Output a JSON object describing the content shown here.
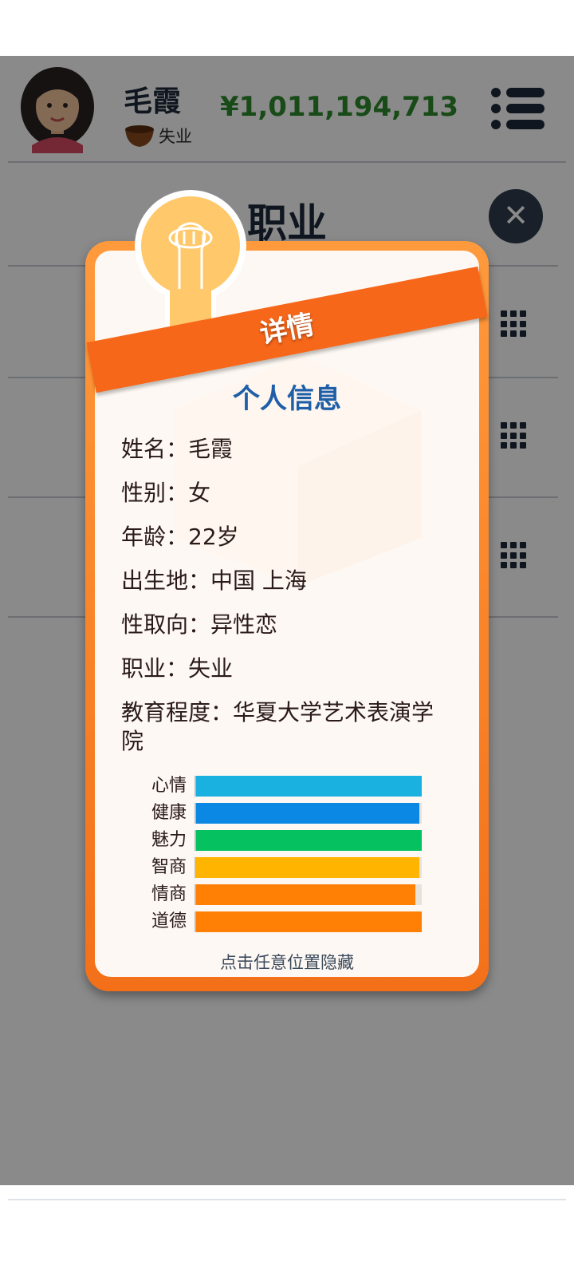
{
  "header": {
    "player_name": "毛霞",
    "job": "失业",
    "money": "¥1,011,194,713"
  },
  "page": {
    "title": "职业"
  },
  "modal": {
    "banner": "详情",
    "title": "个人信息",
    "info": [
      {
        "label": "姓名：",
        "value": "毛霞"
      },
      {
        "label": "性别：",
        "value": "女"
      },
      {
        "label": "年龄：",
        "value": "22岁"
      },
      {
        "label": "出生地：",
        "value": "中国 上海"
      },
      {
        "label": "性取向：",
        "value": "异性恋"
      },
      {
        "label": "职业：",
        "value": "失业"
      },
      {
        "label": "教育程度：",
        "value": "华夏大学艺术表演学院"
      }
    ],
    "stats": [
      {
        "label": "心情",
        "value": 1.0,
        "color": "#1ab0e0"
      },
      {
        "label": "健康",
        "value": 0.99,
        "color": "#0a88e3"
      },
      {
        "label": "魅力",
        "value": 1.0,
        "color": "#05c160"
      },
      {
        "label": "智商",
        "value": 0.99,
        "color": "#ffb400"
      },
      {
        "label": "情商",
        "value": 0.97,
        "color": "#ff8005"
      },
      {
        "label": "道德",
        "value": 1.0,
        "color": "#ff8005"
      }
    ],
    "hint": "点击任意位置隐藏"
  },
  "icons": {
    "avatar": "woman-avatar",
    "job": "bowl-icon",
    "menu": "list-menu-icon",
    "close": "close-icon",
    "row": "grid-icon",
    "bulb": "lightbulb-icon"
  },
  "colors": {
    "money": "#2e8b2e",
    "modal_border": "#f37019",
    "ribbon": "#f7671a",
    "modal_title": "#1f5fa8"
  }
}
